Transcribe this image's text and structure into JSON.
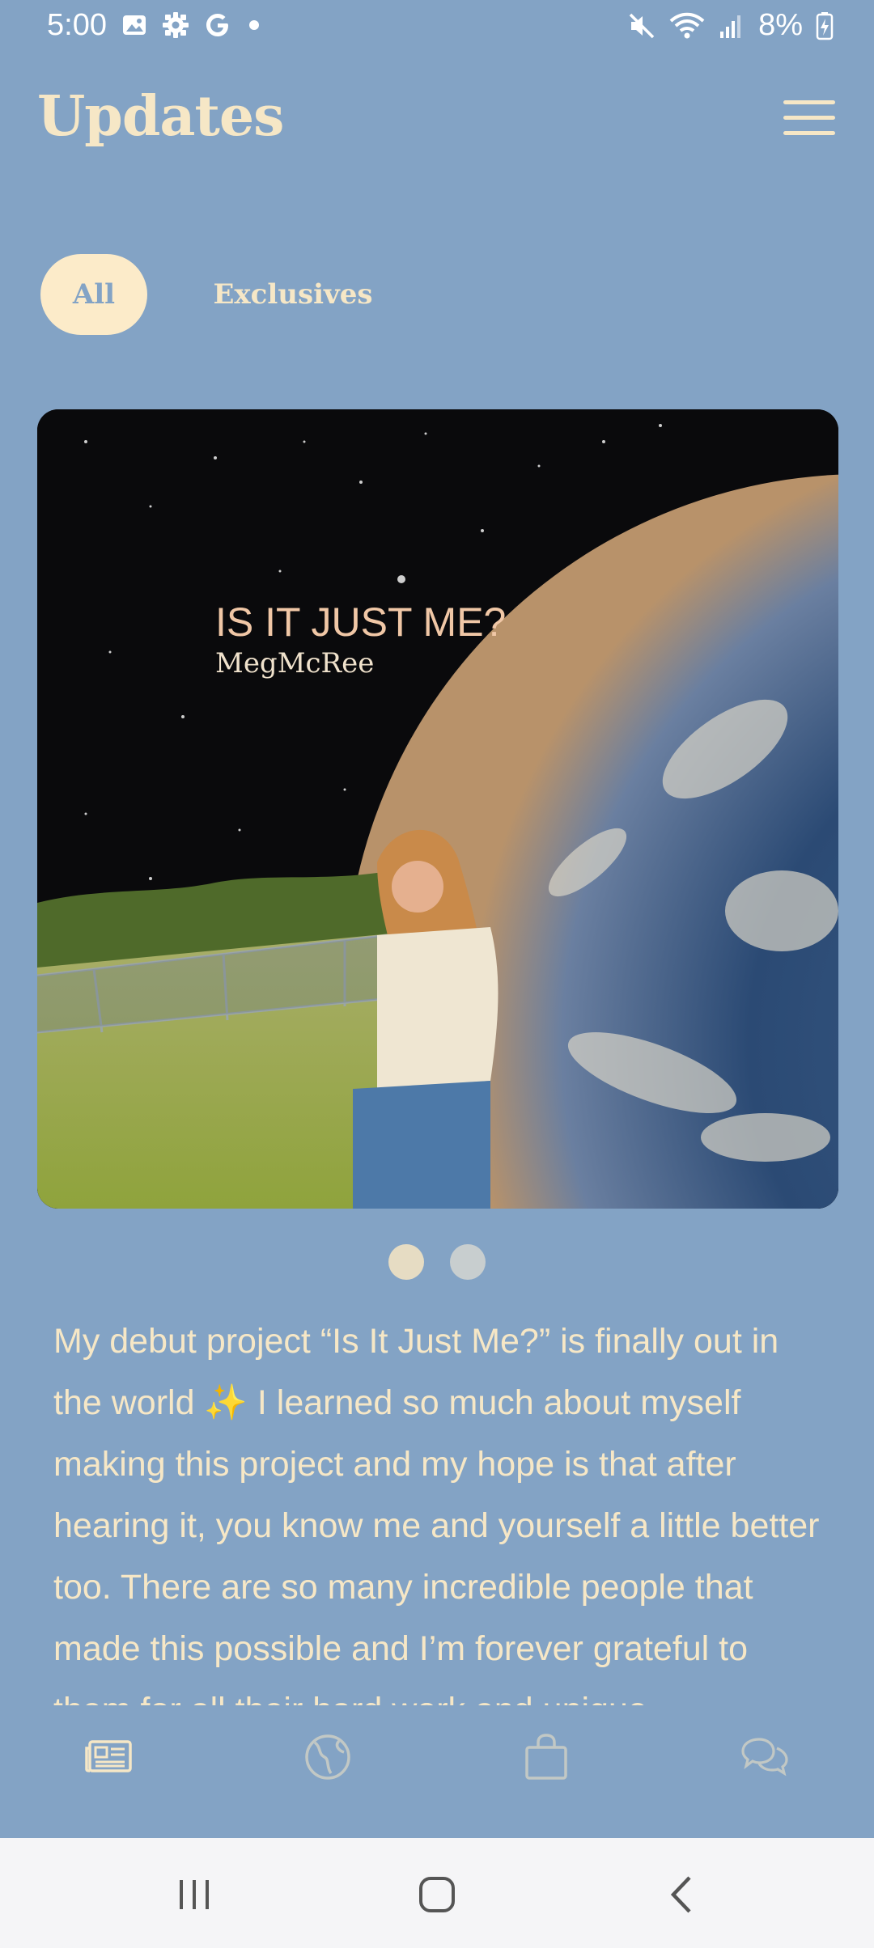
{
  "status_bar": {
    "time": "5:00",
    "battery": "8%",
    "icons": [
      "image-icon",
      "settings-icon",
      "google-icon",
      "dot-icon",
      "mute-icon",
      "wifi-icon",
      "signal-icon",
      "battery-charging-icon"
    ]
  },
  "header": {
    "title": "Updates",
    "menu_icon": "hamburger-menu-icon"
  },
  "tabs": [
    {
      "label": "All",
      "selected": true
    },
    {
      "label": "Exclusives",
      "selected": false
    }
  ],
  "hero": {
    "album_title": "IS IT JUST ME?",
    "artist": "MegMcRee"
  },
  "carousel": {
    "count": 2,
    "active_index": 0
  },
  "post": {
    "text": "My debut project “Is It Just Me?” is finally out in the world ✨ I learned so much about myself making this project and my hope is that after hearing it, you know me and yourself a little better too. There are so many incredible people that made this possible and I’m forever grateful to them for all their hard work and unique"
  },
  "bottom_tabs": [
    {
      "icon": "news-icon",
      "active": true
    },
    {
      "icon": "globe-icon",
      "active": false
    },
    {
      "icon": "shopping-bag-icon",
      "active": false
    },
    {
      "icon": "chat-icon",
      "active": false
    }
  ],
  "colors": {
    "background": "#83a3c5",
    "accent_cream": "#f6e7c6",
    "nav_bar": "#f5f5f7"
  }
}
